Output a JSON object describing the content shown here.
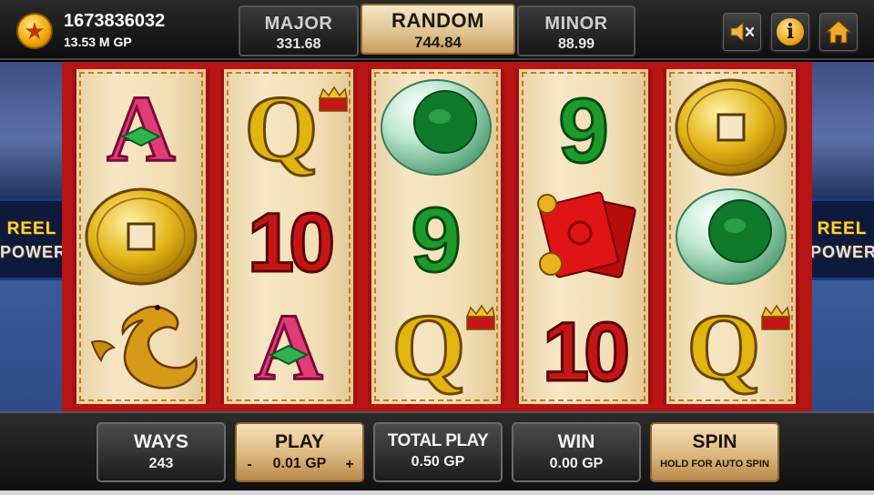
{
  "player": {
    "id": "1673836032",
    "balance": "13.53 M GP",
    "icon": "coin-star-icon"
  },
  "jackpots": {
    "major": {
      "label": "MAJOR",
      "value": "331.68"
    },
    "random": {
      "label": "RANDOM",
      "value": "744.84"
    },
    "minor": {
      "label": "MINOR",
      "value": "88.99"
    }
  },
  "top_buttons": {
    "mute": "mute-speaker-icon",
    "info": "i",
    "home": "home-icon"
  },
  "side_banner": {
    "line1": "REEL",
    "line2": "POWER"
  },
  "reels": [
    [
      "A",
      "coin",
      "dragon"
    ],
    [
      "Q",
      "10",
      "A"
    ],
    [
      "jade",
      "9",
      "Q"
    ],
    [
      "9",
      "envelope",
      "10"
    ],
    [
      "coin",
      "jade",
      "Q"
    ]
  ],
  "bottom": {
    "ways_label": "WAYS",
    "ways_value": "243",
    "play_label": "PLAY",
    "play_value": "0.01 GP",
    "play_minus": "-",
    "play_plus": "+",
    "total_label": "TOTAL PLAY",
    "total_value": "0.50 GP",
    "win_label": "WIN",
    "win_value": "0.00 GP",
    "spin_label": "SPIN",
    "spin_hint": "HOLD FOR AUTO SPIN"
  },
  "colors": {
    "frame_red": "#b81414",
    "reel_bg": "#f3dfb6",
    "gold_panel": "#dcb77f",
    "letter_pink": "#e03c7a",
    "num_green": "#1e9a2a",
    "num_red": "#c41616",
    "letter_gold": "#e2b410"
  }
}
